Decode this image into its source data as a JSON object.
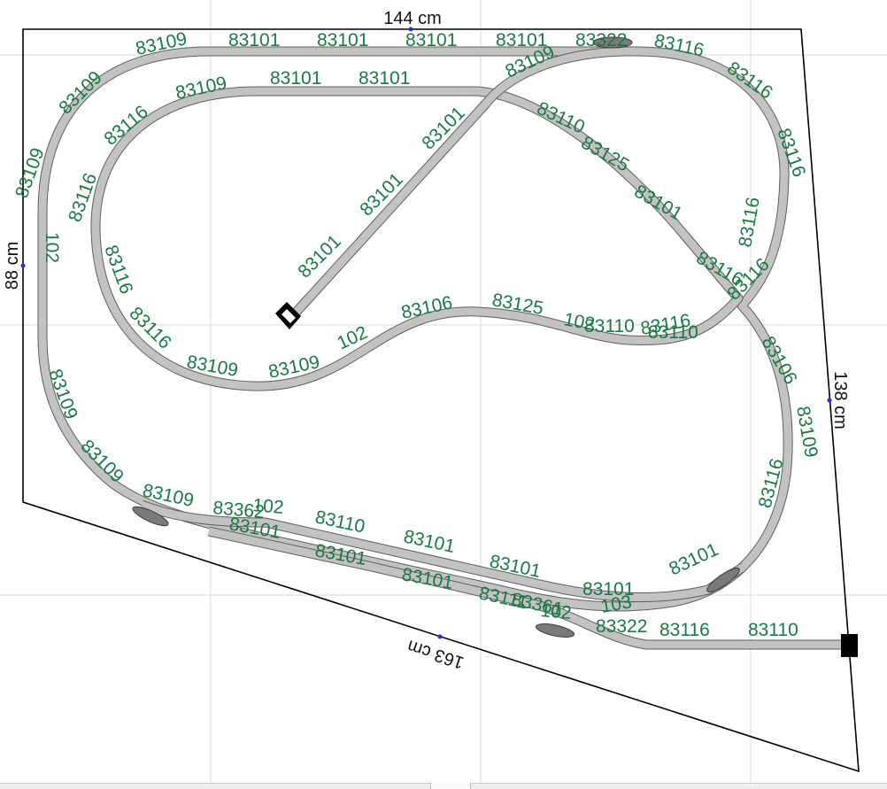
{
  "dimensions": {
    "top": "144 cm",
    "left": "88 cm",
    "right": "138 cm",
    "bottom": "163 cm"
  },
  "track_labels": [
    "83109",
    "83101",
    "83101",
    "83101",
    "83101",
    "83322",
    "83116",
    "83109",
    "83101",
    "83101",
    "83109",
    "83109",
    "83116",
    "83116",
    "83101",
    "83110",
    "83109",
    "83116",
    "83125",
    "83101",
    "83116",
    "83101",
    "83116",
    "83116",
    "83116",
    "83110",
    "102",
    "83101",
    "83116",
    "83106",
    "83125",
    "102",
    "83110",
    "83116",
    "83116",
    "102",
    "83109",
    "83109",
    "83106",
    "83109",
    "83116",
    "83109",
    "83109",
    "83109",
    "83362",
    "102",
    "83110",
    "83101",
    "83101",
    "83101",
    "83101",
    "83101",
    "83101",
    "83101",
    "83111",
    "83361",
    "102",
    "103",
    "83322",
    "83116",
    "83110",
    "83101",
    "83101"
  ],
  "colors": {
    "label": "#1a7a43",
    "track": "#c2c2c2",
    "board": "#000000",
    "grid": "#d9d9d9"
  }
}
